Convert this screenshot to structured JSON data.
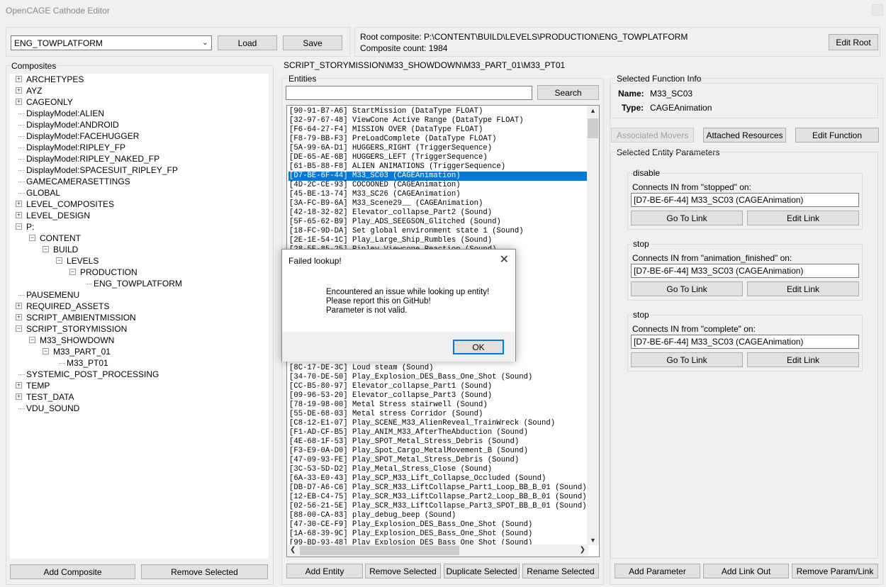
{
  "window": {
    "title": "OpenCAGE Cathode Editor"
  },
  "top": {
    "level_select": "ENG_TOWPLATFORM",
    "load_label": "Load",
    "save_label": "Save",
    "root_composite": "Root composite: P:\\CONTENT\\BUILD\\LEVELS\\PRODUCTION\\ENG_TOWPLATFORM",
    "composite_count": "Composite count: 1984",
    "edit_root_label": "Edit Root"
  },
  "composites": {
    "header": "Composites",
    "items": [
      {
        "label": "ARCHETYPES"
      },
      {
        "label": "AYZ"
      },
      {
        "label": "CAGEONLY"
      },
      {
        "label": "DisplayModel:ALIEN"
      },
      {
        "label": "DisplayModel:ANDROID"
      },
      {
        "label": "DisplayModel:FACEHUGGER"
      },
      {
        "label": "DisplayModel:RIPLEY_FP"
      },
      {
        "label": "DisplayModel:RIPLEY_NAKED_FP"
      },
      {
        "label": "DisplayModel:SPACESUIT_RIPLEY_FP"
      },
      {
        "label": "GAMECAMERASETTINGS"
      },
      {
        "label": "GLOBAL"
      },
      {
        "label": "LEVEL_COMPOSITES"
      },
      {
        "label": "LEVEL_DESIGN"
      },
      {
        "label": "P:"
      },
      {
        "label": "CONTENT"
      },
      {
        "label": "BUILD"
      },
      {
        "label": "LEVELS"
      },
      {
        "label": "PRODUCTION"
      },
      {
        "label": "ENG_TOWPLATFORM"
      },
      {
        "label": "PAUSEMENU"
      },
      {
        "label": "REQUIRED_ASSETS"
      },
      {
        "label": "SCRIPT_AMBIENTMISSION"
      },
      {
        "label": "SCRIPT_STORYMISSION"
      },
      {
        "label": "M33_SHOWDOWN"
      },
      {
        "label": "M33_PART_01"
      },
      {
        "label": "M33_PT01"
      },
      {
        "label": "SYSTEMIC_POST_PROCESSING"
      },
      {
        "label": "TEMP"
      },
      {
        "label": "TEST_DATA"
      },
      {
        "label": "VDU_SOUND"
      }
    ],
    "add_label": "Add Composite",
    "remove_label": "Remove Selected"
  },
  "path": "SCRIPT_STORYMISSION\\M33_SHOWDOWN\\M33_PART_01\\M33_PT01",
  "entities": {
    "header": "Entities",
    "search_value": "",
    "search_label": "Search",
    "rows": [
      "[90-91-B7-A6] StartMission (DataType FLOAT)",
      "[32-97-67-48] ViewCone Active Range (DataType FLOAT)",
      "[F6-64-27-F4] MISSION OVER (DataType FLOAT)",
      "[F8-79-BB-F3] PreLoadComplete (DataType FLOAT)",
      "[5A-99-6A-D1] HUGGERS_RIGHT (TriggerSequence)",
      "[DE-65-AE-6B] HUGGERS_LEFT (TriggerSequence)",
      "[61-B5-88-F8] ALIEN ANIMATIONS (TriggerSequence)",
      "[D7-BE-6F-44] M33_SC03 (CAGEAnimation)",
      "[4D-2C-CE-93] COCOONED (CAGEAnimation)",
      "[45-BE-13-74] M33_SC26 (CAGEAnimation)",
      "[3A-FC-B9-6A] M33_Scene29__ (CAGEAnimation)",
      "[42-18-32-82] Elevator_collapse_Part2 (Sound)",
      "[5F-65-62-B9] Play_ADS_SEEGSON_Glitched (Sound)",
      "[18-FC-9D-DA] Set global environment state 1 (Sound)",
      "[2E-1E-54-1C] Play_Large_Ship_Rumbles (Sound)",
      "[28-5E-85-25] Ripley_Viewcone_Reaction (Sound)"
    ],
    "rows_lower": [
      "[8C-17-DE-3C] Loud steam (Sound)",
      "[34-70-DE-50] Play_Explosion_DES_Bass_One_Shot (Sound)",
      "[CC-B5-80-97] Elevator_collapse_Part1 (Sound)",
      "[09-96-53-20] Elevator_collapse_Part3 (Sound)",
      "[78-19-98-00] Metal Stress stairwell (Sound)",
      "[55-DE-68-03] Metal stress Corridor (Sound)",
      "[C8-12-E1-07] Play_SCENE_M33_AlienReveal_TrainWreck (Sound)",
      "[F1-AD-CF-B5] Play_ANIM_M33_AfterTheAbduction (Sound)",
      "[4E-68-1F-53] Play_SPOT_Metal_Stress_Debris (Sound)",
      "[F3-E9-0A-D0] Play_Spot_Cargo_MetalMovement_B (Sound)",
      "[47-09-93-FE] Play_SPOT_Metal_Stress_Debris (Sound)",
      "[3C-53-5D-D2] Play_Metal_Stress_Close (Sound)",
      "[6A-33-E0-43] Play_SCP_M33_Lift_Collapse_Occluded (Sound)",
      "[DB-D7-A6-C6] Play_SCR_M33_LiftCollapse_Part1_Loop_BB_B_01 (Sound)",
      "[12-EB-C4-75] Play_SCR_M33_LiftCollapse_Part2_Loop_BB_B_01 (Sound)",
      "[02-56-21-5E] Play_SCR_M33_LiftCollapse_Part3_SPOT_BB_B_01 (Sound)",
      "[88-00-CA-83] play_debug_beep (Sound)",
      "[47-30-CE-F9] Play_Explosion_DES_Bass_One_Shot (Sound)",
      "[1A-68-39-9C] Play_Explosion_DES_Bass_One_Shot (Sound)",
      "[99-BD-93-48] Play_Explosion_DES_Bass_One_Shot (Sound)"
    ],
    "add_label": "Add Entity",
    "remove_label": "Remove Selected",
    "duplicate_label": "Duplicate Selected",
    "rename_label": "Rename Selected"
  },
  "function_info": {
    "header": "Selected Function Info",
    "name_label": "Name:",
    "name_value": "M33_SC03",
    "type_label": "Type:",
    "type_value": "CAGEAnimation",
    "associated_movers_label": "Associated Movers",
    "attached_resources_label": "Attached Resources",
    "edit_function_label": "Edit Function"
  },
  "params": {
    "header": "Selected Entity Parameters",
    "groups": [
      {
        "title": "disable",
        "connects": "Connects IN from \"stopped\" on:",
        "value": "[D7-BE-6F-44] M33_SC03 (CAGEAnimation)",
        "goto_label": "Go To Link",
        "edit_label": "Edit Link"
      },
      {
        "title": "stop",
        "connects": "Connects IN from \"animation_finished\" on:",
        "value": "[D7-BE-6F-44] M33_SC03 (CAGEAnimation)",
        "goto_label": "Go To Link",
        "edit_label": "Edit Link"
      },
      {
        "title": "stop",
        "connects": "Connects IN from \"complete\" on:",
        "value": "[D7-BE-6F-44] M33_SC03 (CAGEAnimation)",
        "goto_label": "Go To Link",
        "edit_label": "Edit Link"
      }
    ],
    "add_param_label": "Add Parameter",
    "add_link_label": "Add Link Out",
    "remove_label": "Remove Param/Link"
  },
  "dialog": {
    "title": "Failed lookup!",
    "line1": "Encountered an issue while looking up entity!",
    "line2": "Please report this on GitHub!",
    "line3": "Parameter is not valid.",
    "ok_label": "OK"
  },
  "colors": {
    "selection": "#0078d7",
    "window_bg": "#f0f0f0"
  }
}
